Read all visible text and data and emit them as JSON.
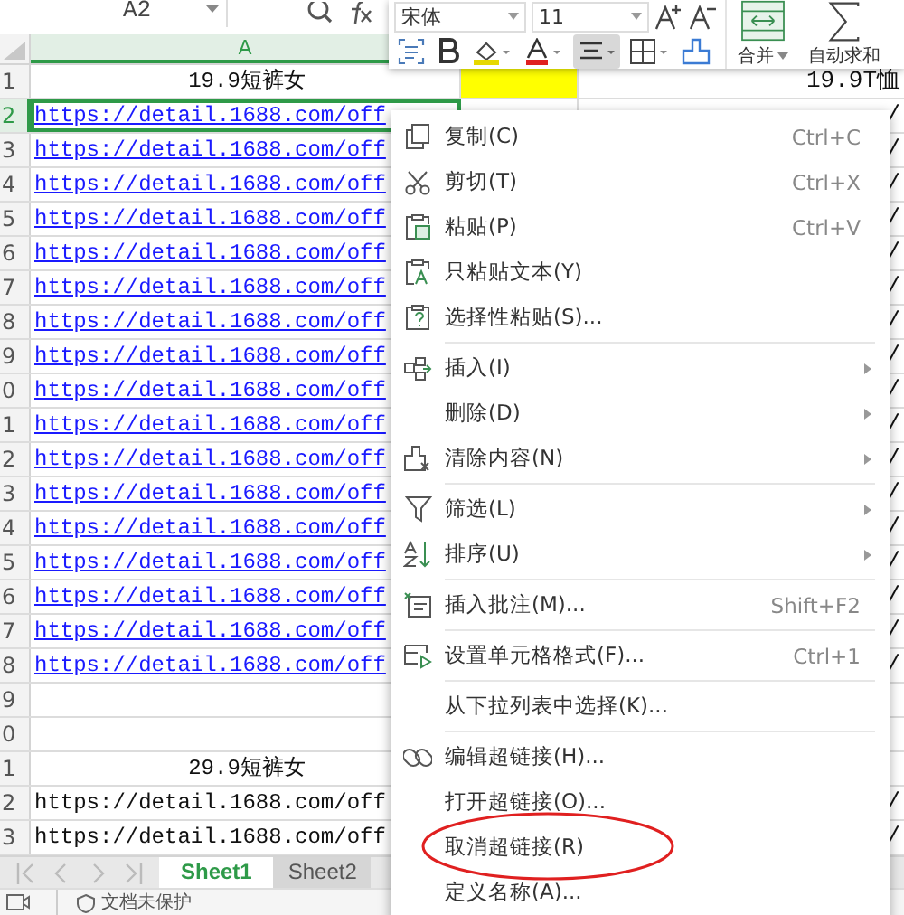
{
  "formula_bar": {
    "name_box": "A2"
  },
  "columns": [
    {
      "label": "A",
      "selected": true
    }
  ],
  "rows": [
    {
      "header": "1",
      "selected": false,
      "centered": true,
      "a": "19.9短裤女",
      "link": false,
      "color": "#ffff00",
      "c": "19.9T恤"
    },
    {
      "header": "2",
      "selected": true,
      "centered": false,
      "a": "https://detail.1688.com/off",
      "link": true,
      "c": "/"
    },
    {
      "header": "3",
      "selected": false,
      "centered": false,
      "a": "https://detail.1688.com/off",
      "link": true,
      "c": "/"
    },
    {
      "header": "4",
      "selected": false,
      "centered": false,
      "a": "https://detail.1688.com/off",
      "link": true,
      "c": "/"
    },
    {
      "header": "5",
      "selected": false,
      "centered": false,
      "a": "https://detail.1688.com/off",
      "link": true,
      "c": "/"
    },
    {
      "header": "6",
      "selected": false,
      "centered": false,
      "a": "https://detail.1688.com/off",
      "link": true,
      "c": "/"
    },
    {
      "header": "7",
      "selected": false,
      "centered": false,
      "a": "https://detail.1688.com/off",
      "link": true,
      "c": "/"
    },
    {
      "header": "8",
      "selected": false,
      "centered": false,
      "a": "https://detail.1688.com/off",
      "link": true,
      "c": "/"
    },
    {
      "header": "9",
      "selected": false,
      "centered": false,
      "a": "https://detail.1688.com/off",
      "link": true,
      "c": "/"
    },
    {
      "header": "0",
      "selected": false,
      "centered": false,
      "a": "https://detail.1688.com/off",
      "link": true,
      "c": "/"
    },
    {
      "header": "1",
      "selected": false,
      "centered": false,
      "a": "https://detail.1688.com/off",
      "link": true,
      "c": "/"
    },
    {
      "header": "2",
      "selected": false,
      "centered": false,
      "a": "https://detail.1688.com/off",
      "link": true,
      "c": "/"
    },
    {
      "header": "3",
      "selected": false,
      "centered": false,
      "a": "https://detail.1688.com/off",
      "link": true,
      "c": "/"
    },
    {
      "header": "4",
      "selected": false,
      "centered": false,
      "a": "https://detail.1688.com/off",
      "link": true,
      "c": "/"
    },
    {
      "header": "5",
      "selected": false,
      "centered": false,
      "a": "https://detail.1688.com/off",
      "link": true,
      "c": "/"
    },
    {
      "header": "6",
      "selected": false,
      "centered": false,
      "a": "https://detail.1688.com/off",
      "link": true,
      "c": "/"
    },
    {
      "header": "7",
      "selected": false,
      "centered": false,
      "a": "https://detail.1688.com/off",
      "link": true,
      "c": "/"
    },
    {
      "header": "8",
      "selected": false,
      "centered": false,
      "a": "https://detail.1688.com/off",
      "link": true,
      "c": "/"
    },
    {
      "header": "9",
      "selected": false
    },
    {
      "header": "0",
      "selected": false
    },
    {
      "header": "1",
      "selected": false,
      "centered": true,
      "a": "29.9短裤女",
      "link": false
    },
    {
      "header": "2",
      "selected": false,
      "centered": false,
      "a": "https://detail.1688.com/off",
      "link": false,
      "c": "/"
    },
    {
      "header": "3",
      "selected": false,
      "centered": false,
      "a": "https://detail.1688.com/off",
      "link": false,
      "c": "/"
    }
  ],
  "mini_toolbar": {
    "font": "宋体",
    "size": "11",
    "format_buttons": [
      {
        "selected": false
      },
      {
        "selected": false
      },
      {
        "selected": false
      },
      {
        "selected": false
      },
      {
        "selected": true
      },
      {
        "selected": false
      },
      {
        "selected": false
      }
    ],
    "big_buttons": [
      {
        "label": "合并",
        "dropdown": true
      },
      {
        "label": "自动求和",
        "dropdown": false
      }
    ]
  },
  "context_menu": {
    "groups": [
      [
        {
          "label": "复制(C)",
          "shortcut": "Ctrl+C",
          "submenu": false
        },
        {
          "label": "剪切(T)",
          "shortcut": "Ctrl+X",
          "submenu": false
        },
        {
          "label": "粘贴(P)",
          "shortcut": "Ctrl+V",
          "submenu": false
        },
        {
          "label": "只粘贴文本(Y)",
          "submenu": false
        },
        {
          "label": "选择性粘贴(S)...",
          "submenu": false
        }
      ],
      [
        {
          "label": "插入(I)",
          "submenu": true
        },
        {
          "label": "删除(D)",
          "submenu": true
        },
        {
          "label": "清除内容(N)",
          "submenu": true
        }
      ],
      [
        {
          "label": "筛选(L)",
          "submenu": true
        },
        {
          "label": "排序(U)",
          "submenu": true
        }
      ],
      [
        {
          "label": "插入批注(M)...",
          "shortcut": "Shift+F2",
          "submenu": false
        }
      ],
      [
        {
          "label": "设置单元格格式(F)...",
          "shortcut": "Ctrl+1",
          "submenu": false
        }
      ],
      [
        {
          "label": "从下拉列表中选择(K)...",
          "submenu": false
        }
      ],
      [
        {
          "label": "编辑超链接(H)...",
          "submenu": false
        },
        {
          "label": "打开超链接(O)...",
          "submenu": false
        },
        {
          "label": "取消超链接(R)",
          "submenu": false,
          "circled": true
        },
        {
          "label": "定义名称(A)...",
          "submenu": false
        }
      ]
    ]
  },
  "sheet_tabs": [
    {
      "label": "Sheet1",
      "selected": true
    },
    {
      "label": "Sheet2",
      "selected": false
    }
  ],
  "status_bar": {
    "protection": "文档未保护"
  }
}
